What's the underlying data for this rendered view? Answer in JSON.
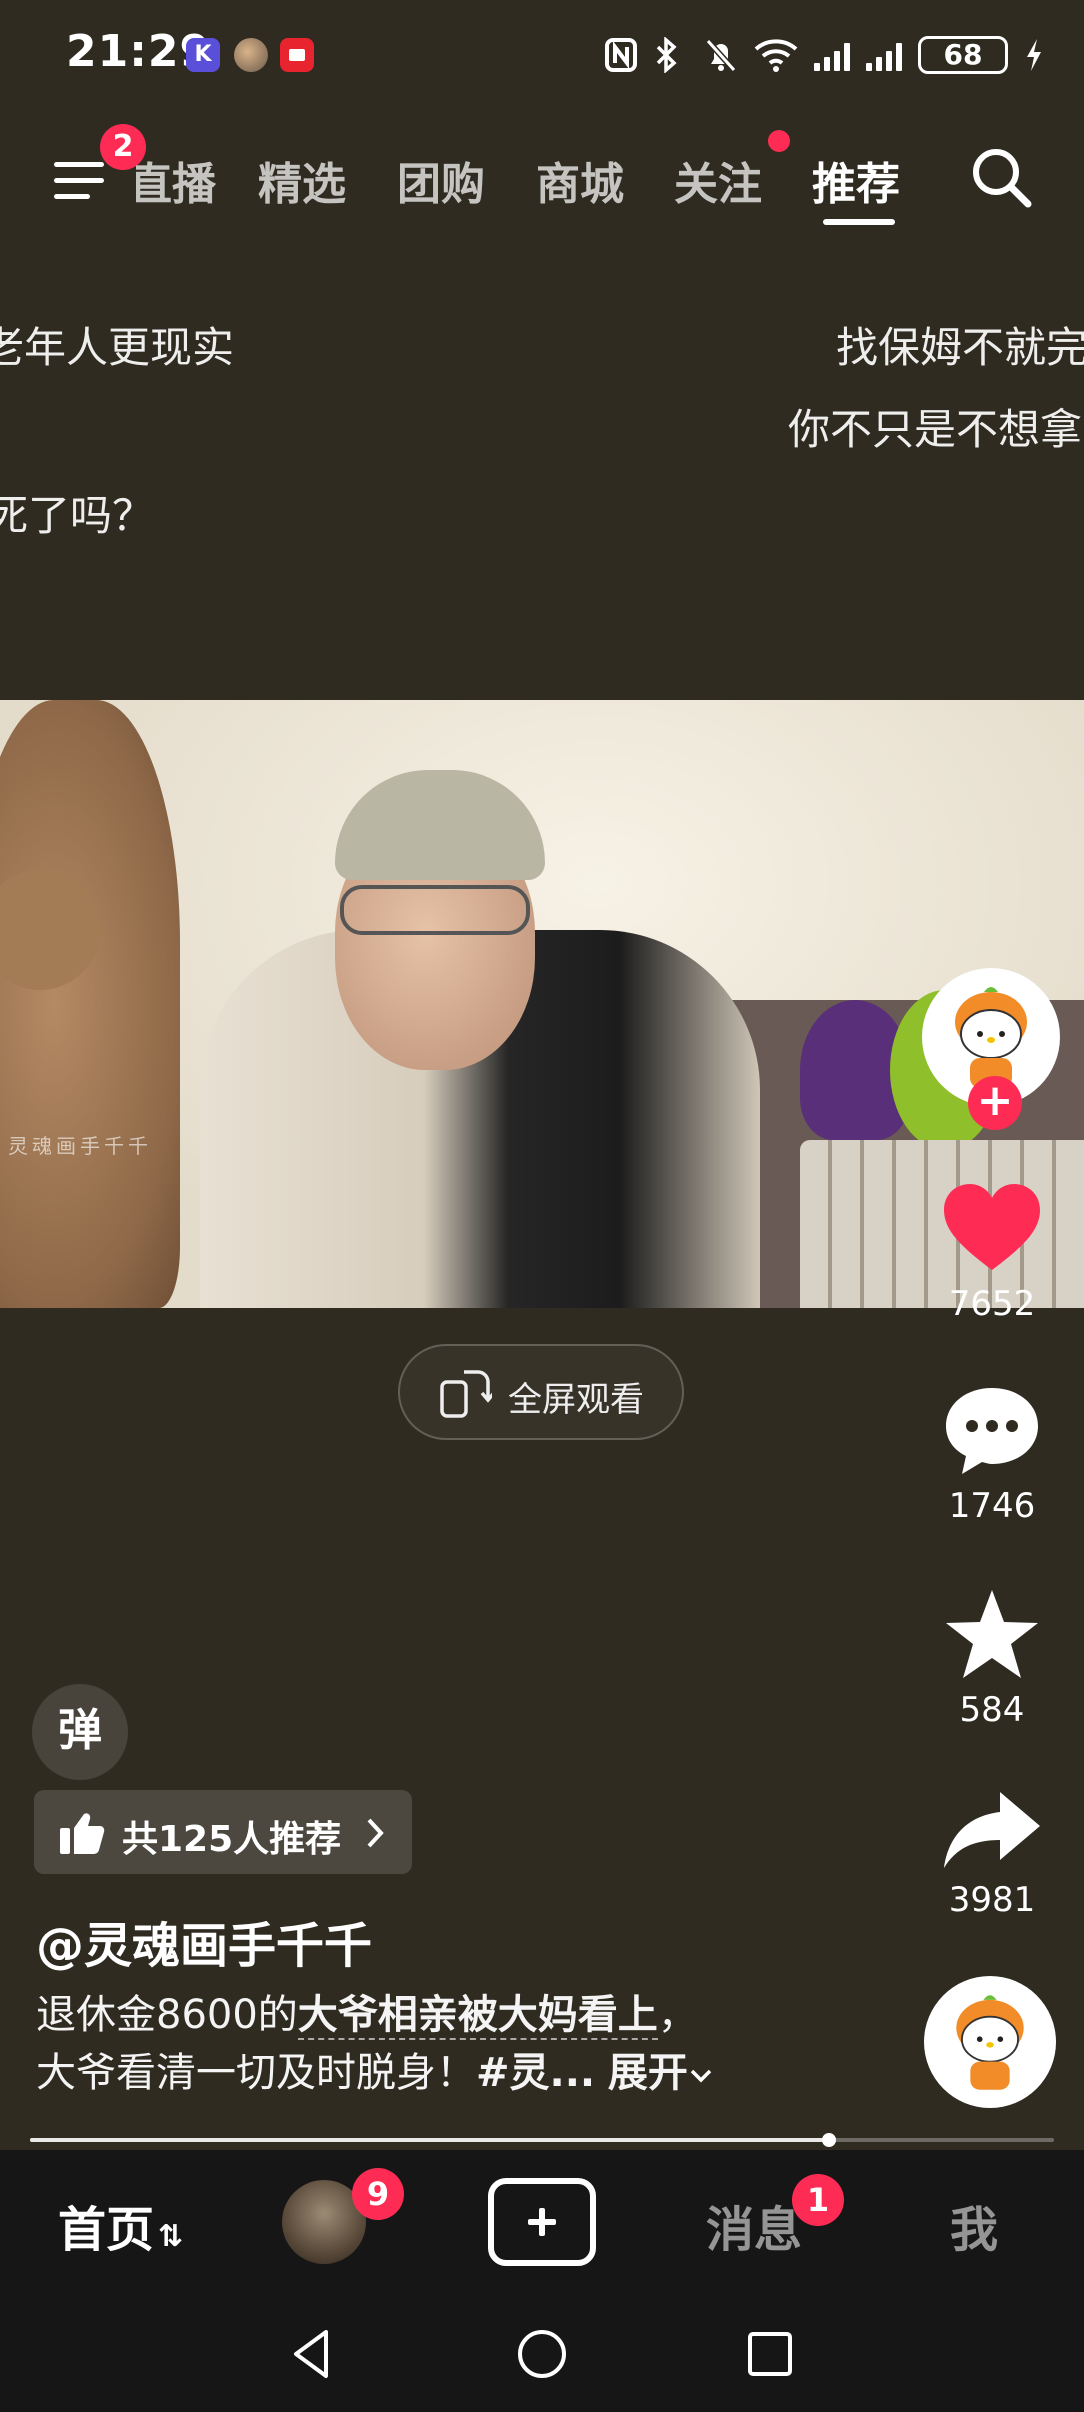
{
  "status_bar": {
    "time": "21:29",
    "notification_k": "K",
    "battery": "68"
  },
  "top_nav": {
    "menu_badge": "2",
    "tabs": [
      "直播",
      "精选",
      "团购",
      "商城",
      "关注",
      "推荐"
    ],
    "active_tab": "推荐"
  },
  "danmaku": [
    "老年人更现实",
    "找保姆不就完",
    "你不只是不想拿",
    "死了吗？"
  ],
  "video": {
    "watermark": "灵魂画手千千",
    "fullscreen_label": "全屏观看"
  },
  "actions": {
    "like_count": "7652",
    "comment_count": "1746",
    "favorite_count": "584",
    "share_count": "3981"
  },
  "info": {
    "danmaku_toggle": "弹",
    "recommend": "共125人推荐",
    "author": "@灵魂画手千千",
    "caption_prefix": "退休金8600的",
    "caption_highlight": "大爷相亲被大妈看上",
    "caption_comma": "，",
    "caption_line2": "大爷看清一切及时脱身！",
    "caption_tag": "#灵...",
    "expand": "展开"
  },
  "progress": {
    "played_fraction": 0.78
  },
  "tab_bar": {
    "home": "首页",
    "friends_badge": "9",
    "messages": "消息",
    "messages_badge": "1",
    "me": "我"
  },
  "colors": {
    "background": "#2f2b21",
    "accent": "#fe2c55",
    "like": "#fe2c55"
  }
}
